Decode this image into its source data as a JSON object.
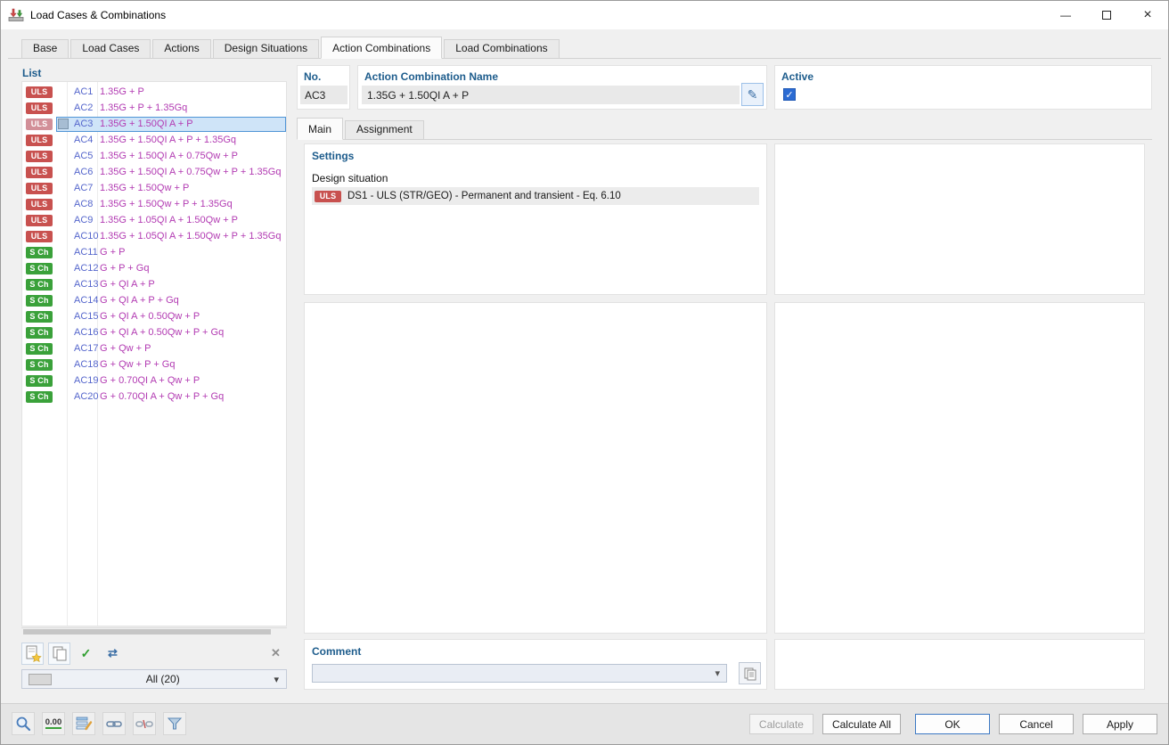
{
  "window": {
    "title": "Load Cases & Combinations"
  },
  "glyphs": {
    "minimize": "—",
    "close": "×",
    "pencil": "✎",
    "chevron_down": "▾",
    "check": "✓",
    "swap_arrows": "⇄",
    "delete_x": "✕"
  },
  "tabs": [
    "Base",
    "Load Cases",
    "Actions",
    "Design Situations",
    "Action Combinations",
    "Load Combinations"
  ],
  "active_tab": "Action Combinations",
  "subtabs": [
    "Main",
    "Assignment"
  ],
  "active_subtab": "Main",
  "list": {
    "header": "List",
    "filter_value": "All (20)",
    "items": [
      {
        "badge": "ULS",
        "kind": "uls",
        "no": "AC1",
        "name": "1.35G + P"
      },
      {
        "badge": "ULS",
        "kind": "uls",
        "no": "AC2",
        "name": "1.35G + P + 1.35Gq"
      },
      {
        "badge": "ULS",
        "kind": "uls",
        "no": "AC3",
        "name": "1.35G + 1.50QI A + P",
        "selected": true
      },
      {
        "badge": "ULS",
        "kind": "uls",
        "no": "AC4",
        "name": "1.35G + 1.50QI A + P + 1.35Gq"
      },
      {
        "badge": "ULS",
        "kind": "uls",
        "no": "AC5",
        "name": "1.35G + 1.50QI A + 0.75Qw + P"
      },
      {
        "badge": "ULS",
        "kind": "uls",
        "no": "AC6",
        "name": "1.35G + 1.50QI A + 0.75Qw + P + 1.35Gq"
      },
      {
        "badge": "ULS",
        "kind": "uls",
        "no": "AC7",
        "name": "1.35G + 1.50Qw + P"
      },
      {
        "badge": "ULS",
        "kind": "uls",
        "no": "AC8",
        "name": "1.35G + 1.50Qw + P + 1.35Gq"
      },
      {
        "badge": "ULS",
        "kind": "uls",
        "no": "AC9",
        "name": "1.35G + 1.05QI A + 1.50Qw + P"
      },
      {
        "badge": "ULS",
        "kind": "uls",
        "no": "AC10",
        "name": "1.35G + 1.05QI A + 1.50Qw + P + 1.35Gq"
      },
      {
        "badge": "S Ch",
        "kind": "sch",
        "no": "AC11",
        "name": "G + P"
      },
      {
        "badge": "S Ch",
        "kind": "sch",
        "no": "AC12",
        "name": "G + P + Gq"
      },
      {
        "badge": "S Ch",
        "kind": "sch",
        "no": "AC13",
        "name": "G + QI A + P"
      },
      {
        "badge": "S Ch",
        "kind": "sch",
        "no": "AC14",
        "name": "G + QI A + P + Gq"
      },
      {
        "badge": "S Ch",
        "kind": "sch",
        "no": "AC15",
        "name": "G + QI A + 0.50Qw + P"
      },
      {
        "badge": "S Ch",
        "kind": "sch",
        "no": "AC16",
        "name": "G + QI A + 0.50Qw + P + Gq"
      },
      {
        "badge": "S Ch",
        "kind": "sch",
        "no": "AC17",
        "name": "G + Qw + P"
      },
      {
        "badge": "S Ch",
        "kind": "sch",
        "no": "AC18",
        "name": "G + Qw + P + Gq"
      },
      {
        "badge": "S Ch",
        "kind": "sch",
        "no": "AC19",
        "name": "G + 0.70QI A + Qw + P"
      },
      {
        "badge": "S Ch",
        "kind": "sch",
        "no": "AC20",
        "name": "G + 0.70QI A + Qw + P + Gq"
      }
    ]
  },
  "details": {
    "no_label": "No.",
    "no_value": "AC3",
    "name_label": "Action Combination Name",
    "name_value": "1.35G + 1.50QI A + P",
    "active_label": "Active"
  },
  "main_panel": {
    "settings_header": "Settings",
    "design_situation_label": "Design situation",
    "design_situation_badge": "ULS",
    "design_situation_text": "DS1 - ULS (STR/GEO) - Permanent and transient - Eq. 6.10",
    "comment_header": "Comment",
    "comment_value": ""
  },
  "footer": {
    "toolbar_zero": "0.00",
    "calculate": "Calculate",
    "calculate_all": "Calculate All",
    "ok": "OK",
    "cancel": "Cancel",
    "apply": "Apply"
  },
  "colors": {
    "header_blue": "#1d5c8c",
    "uls_badge": "#c8514f",
    "uls_badge_selected": "#d28f98",
    "sch_badge": "#3aa13a",
    "item_no": "#5566cc",
    "item_name": "#b23ab2",
    "selection_bg": "#cfe4f8",
    "selection_border": "#4f94d6",
    "active_checkbox": "#2b6bd3"
  }
}
